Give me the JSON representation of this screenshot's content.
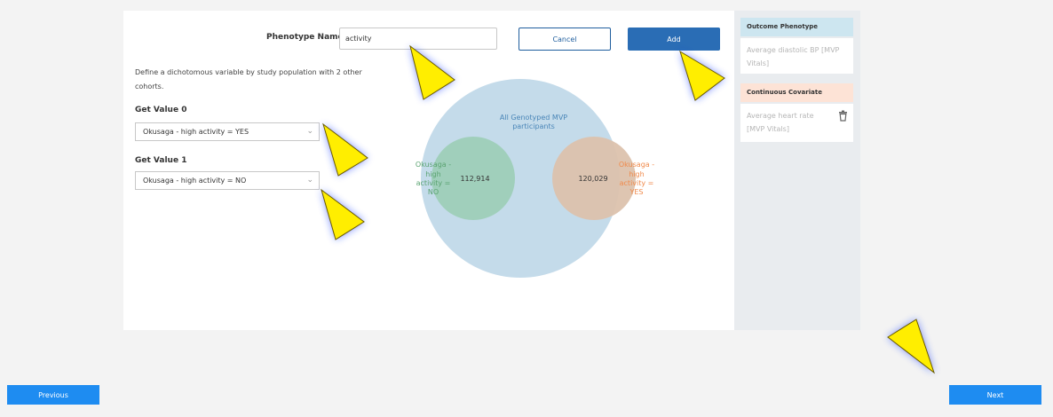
{
  "form": {
    "phenotype_label": "Phenotype Name",
    "phenotype_value": "activity",
    "cancel_label": "Cancel",
    "add_label": "Add",
    "description": "Define a dichotomous variable by study population with 2 other cohorts.",
    "value0_label": "Get Value 0",
    "value0_selected": "Okusaga - high activity = YES",
    "value1_label": "Get Value 1",
    "value1_selected": "Okusaga - high activity = NO"
  },
  "venn": {
    "main_label": "All Genotyped MVP participants",
    "left_label": "Okusaga - high activity = NO",
    "left_count": "112,914",
    "right_label": "Okusaga - high activity = YES",
    "right_count": "120,029",
    "colors": {
      "main": "#c4dbea",
      "left": "#9ecfb8",
      "right": "#dcc2ad"
    }
  },
  "sidebar": {
    "outcome_header": "Outcome Phenotype",
    "outcome_item": "Average diastolic BP [MVP Vitals]",
    "covariate_header": "Continuous Covariate",
    "covariate_item": "Average heart rate [MVP Vitals]",
    "outcome_color": "#cde6f0",
    "covariate_color": "#fde3d6"
  },
  "nav": {
    "previous_label": "Previous",
    "next_label": "Next"
  }
}
